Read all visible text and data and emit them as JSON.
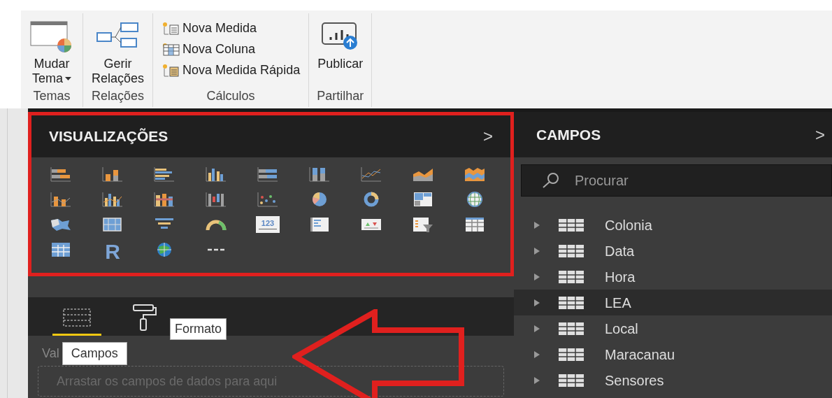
{
  "ribbon": {
    "groups": [
      {
        "label": "Temas",
        "kind": "theme",
        "buttons": [
          {
            "label": "Mudar",
            "label2": "Tema",
            "dropdown": true
          }
        ]
      },
      {
        "label": "Relações",
        "kind": "relations",
        "buttons": [
          {
            "label": "Gerir",
            "label2": "Relações"
          }
        ]
      },
      {
        "label": "Cálculos",
        "kind": "calc",
        "buttons": [
          {
            "label": "Nova Medida",
            "kind": "measure"
          },
          {
            "label": "Nova Coluna",
            "kind": "column"
          },
          {
            "label": "Nova Medida Rápida",
            "kind": "quick"
          }
        ]
      },
      {
        "label": "Partilhar",
        "kind": "publish",
        "buttons": [
          {
            "label": "Publicar"
          }
        ]
      }
    ]
  },
  "visualizations": {
    "title": "VISUALIZAÇÕES",
    "collapse": ">",
    "visuals": [
      {
        "kind": "stacked-bar"
      },
      {
        "kind": "stacked-column"
      },
      {
        "kind": "clustered-bar"
      },
      {
        "kind": "clustered-column"
      },
      {
        "kind": "bar100"
      },
      {
        "kind": "column100"
      },
      {
        "kind": "line"
      },
      {
        "kind": "area"
      },
      {
        "kind": "stacked-area"
      },
      {
        "kind": "line-column"
      },
      {
        "kind": "line-clustered"
      },
      {
        "kind": "ribbon"
      },
      {
        "kind": "waterfall"
      },
      {
        "kind": "scatter"
      },
      {
        "kind": "pie"
      },
      {
        "kind": "donut"
      },
      {
        "kind": "treemap"
      },
      {
        "kind": "map"
      },
      {
        "kind": "filled-map"
      },
      {
        "kind": "shape-map"
      },
      {
        "kind": "funnel"
      },
      {
        "kind": "gauge"
      },
      {
        "kind": "card",
        "text": "123"
      },
      {
        "kind": "multirow"
      },
      {
        "kind": "kpi"
      },
      {
        "kind": "slicer"
      },
      {
        "kind": "table"
      },
      {
        "kind": "matrix"
      },
      {
        "kind": "letter",
        "text": "R"
      },
      {
        "kind": "globe"
      },
      {
        "kind": "more"
      }
    ],
    "tabs": [
      {
        "kind": "fields",
        "selected": true,
        "tooltip": "Campos"
      },
      {
        "kind": "format",
        "selected": false,
        "tooltip": "Formato"
      }
    ],
    "well_label": "Val",
    "drop_placeholder": "Arrastar os campos de dados para aqui"
  },
  "fields": {
    "title": "CAMPOS",
    "collapse": ">",
    "search": {
      "placeholder": "Procurar"
    },
    "tables": [
      {
        "label": "Colonia",
        "selected": false
      },
      {
        "label": "Data",
        "selected": false
      },
      {
        "label": "Hora",
        "selected": false
      },
      {
        "label": "LEA",
        "selected": true
      },
      {
        "label": "Local",
        "selected": false
      },
      {
        "label": "Maracanau",
        "selected": false
      },
      {
        "label": "Sensores",
        "selected": false
      }
    ]
  }
}
